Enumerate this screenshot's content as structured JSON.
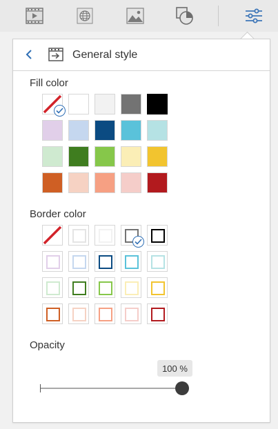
{
  "tabs": [
    {
      "name": "slides-tab",
      "icon": "film-icon"
    },
    {
      "name": "web-tab",
      "icon": "globe-icon"
    },
    {
      "name": "image-tab",
      "icon": "image-icon"
    },
    {
      "name": "shapes-tab",
      "icon": "shapes-icon"
    },
    {
      "name": "settings-tab",
      "icon": "sliders-icon",
      "active": true
    }
  ],
  "panel": {
    "title": "General style",
    "fill_label": "Fill color",
    "border_label": "Border color",
    "opacity_label": "Opacity",
    "opacity_value": "100 %",
    "opacity_fraction": 1.0
  },
  "fill_colors": [
    [
      "none",
      "#ffffff",
      "#f2f2f2",
      "#737373",
      "#000000"
    ],
    [
      "#e1cfe9",
      "#c5d7ef",
      "#0b4b82",
      "#5ac2da",
      "#b5e2e4"
    ],
    [
      "#cfead0",
      "#3f7d1f",
      "#86c74a",
      "#fbeeb6",
      "#f2c42f"
    ],
    [
      "#cf5f24",
      "#f6d2c3",
      "#f6a083",
      "#f5cdc9",
      "#b21a1e"
    ]
  ],
  "fill_selected": "none",
  "border_colors": [
    [
      "none",
      "#ffffff",
      "#f2f2f2",
      "#737373",
      "#000000"
    ],
    [
      "#e1cfe9",
      "#c5d7ef",
      "#0b4b82",
      "#5ac2da",
      "#b5e2e4"
    ],
    [
      "#cfead0",
      "#3f7d1f",
      "#86c74a",
      "#fbeeb6",
      "#f2c42f"
    ],
    [
      "#cf5f24",
      "#f6d2c3",
      "#f6a083",
      "#f5cdc9",
      "#b21a1e"
    ]
  ],
  "border_selected": "#737373",
  "accent_color": "#2f6fb5"
}
